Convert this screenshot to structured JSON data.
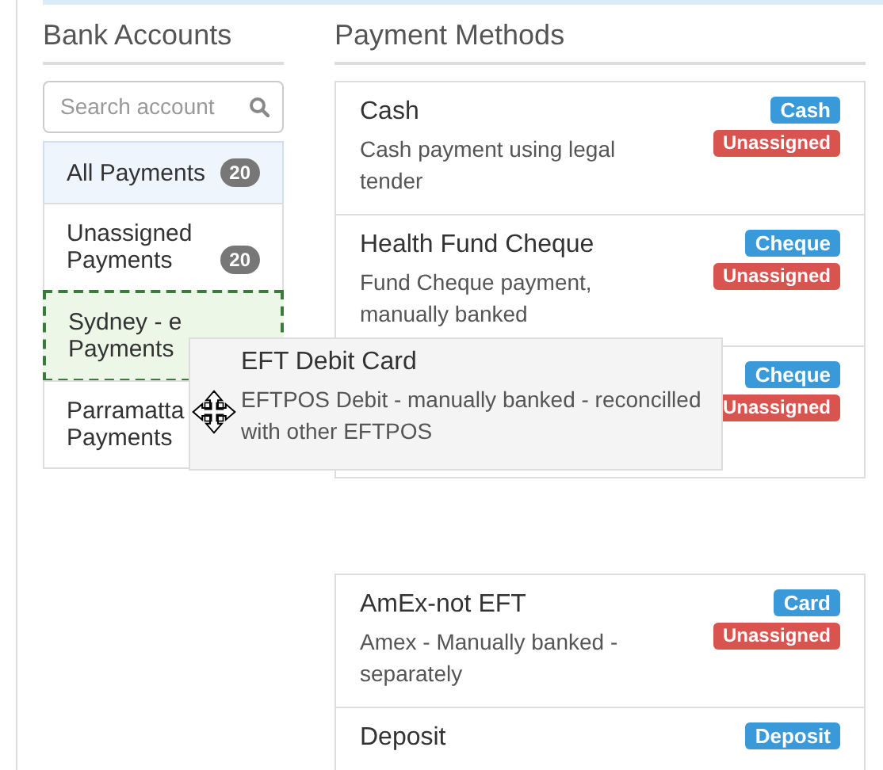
{
  "bank_accounts": {
    "title": "Bank Accounts",
    "search": {
      "placeholder": "Search account"
    },
    "items": [
      {
        "name": "All Payments",
        "count": "20",
        "selected": true,
        "drop_target": false
      },
      {
        "name": "Unassigned Payments",
        "count": "20",
        "selected": false,
        "drop_target": false
      },
      {
        "name": "Sydney - e Payments",
        "selected": false,
        "drop_target": true
      },
      {
        "name": "Parramatta Payments",
        "selected": false,
        "drop_target": false
      }
    ]
  },
  "payment_methods": {
    "title": "Payment Methods",
    "groups": [
      [
        {
          "name": "Cash",
          "description": "Cash payment using legal tender",
          "type": "Cash",
          "status": "Unassigned"
        },
        {
          "name": "Health Fund Cheque",
          "description": "Fund Cheque payment, manually banked",
          "type": "Cheque",
          "status": "Unassigned"
        },
        {
          "type": "Cheque",
          "status": "Unassigned"
        }
      ],
      [
        {
          "name": "AmEx-not EFT",
          "description": "Amex - Manually banked - separately",
          "type": "Card",
          "status": "Unassigned"
        },
        {
          "name": "Deposit",
          "type": "Deposit"
        }
      ]
    ]
  },
  "drag_item": {
    "name": "EFT Debit Card",
    "description": "EFTPOS Debit - manually banked - reconcilled with other EFTPOS"
  }
}
